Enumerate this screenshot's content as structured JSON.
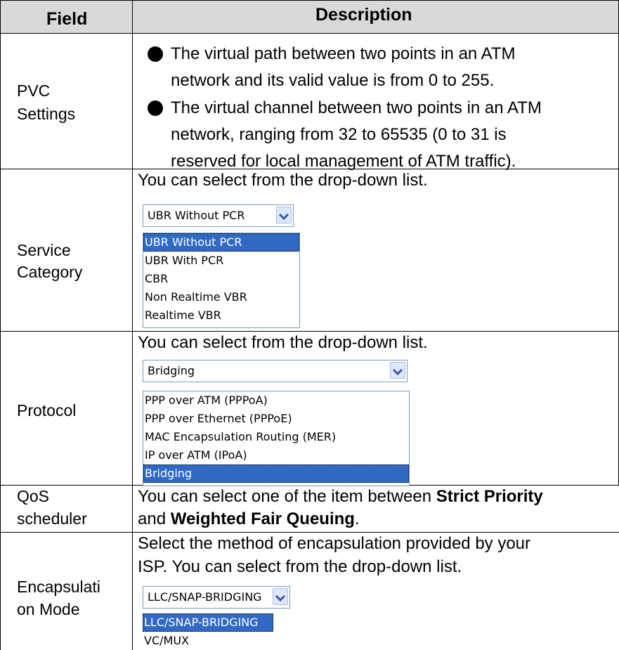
{
  "headers": {
    "field": "Field",
    "description": "Description"
  },
  "rows": {
    "pvc": {
      "field": [
        "PVC",
        "Settings"
      ],
      "bullets": [
        [
          "The virtual path between two points in an ATM",
          "network and its valid value is from 0 to 255."
        ],
        [
          "The virtual channel between two points in an ATM",
          "network, ranging from 32 to 65535 (0 to 31 is",
          "reserved for local management of ATM traffic)."
        ]
      ]
    },
    "service": {
      "field": [
        "Service",
        "Category"
      ],
      "text": "You can select from the drop-down list.",
      "dropdown": {
        "selected": "UBR Without PCR",
        "options": [
          "UBR Without PCR",
          "UBR With PCR",
          "CBR",
          "Non Realtime VBR",
          "Realtime VBR"
        ],
        "highlighted_index": 0
      }
    },
    "protocol": {
      "field": [
        "Protocol"
      ],
      "text": "You can select from the drop-down list.",
      "dropdown": {
        "selected": "Bridging",
        "options": [
          "PPP over ATM (PPPoA)",
          "PPP over Ethernet (PPPoE)",
          "MAC Encapsulation Routing (MER)",
          "IP over ATM (IPoA)",
          "Bridging"
        ],
        "highlighted_index": 4
      }
    },
    "qos": {
      "field": [
        "QoS",
        "scheduler"
      ],
      "text_before": "You can select one of the item between ",
      "bold1": "Strict Priority",
      "text_and": "and ",
      "bold2": "Weighted Fair Queuing",
      "text_end": "."
    },
    "encap": {
      "field": [
        "Encapsulati",
        "on Mode"
      ],
      "lines": [
        "Select the method of encapsulation provided by your",
        "ISP. You can select from the drop-down list."
      ],
      "dropdown": {
        "selected": "LLC/SNAP-BRIDGING",
        "options": [
          "LLC/SNAP-BRIDGING",
          "VC/MUX"
        ],
        "highlighted_index": 0
      }
    }
  }
}
